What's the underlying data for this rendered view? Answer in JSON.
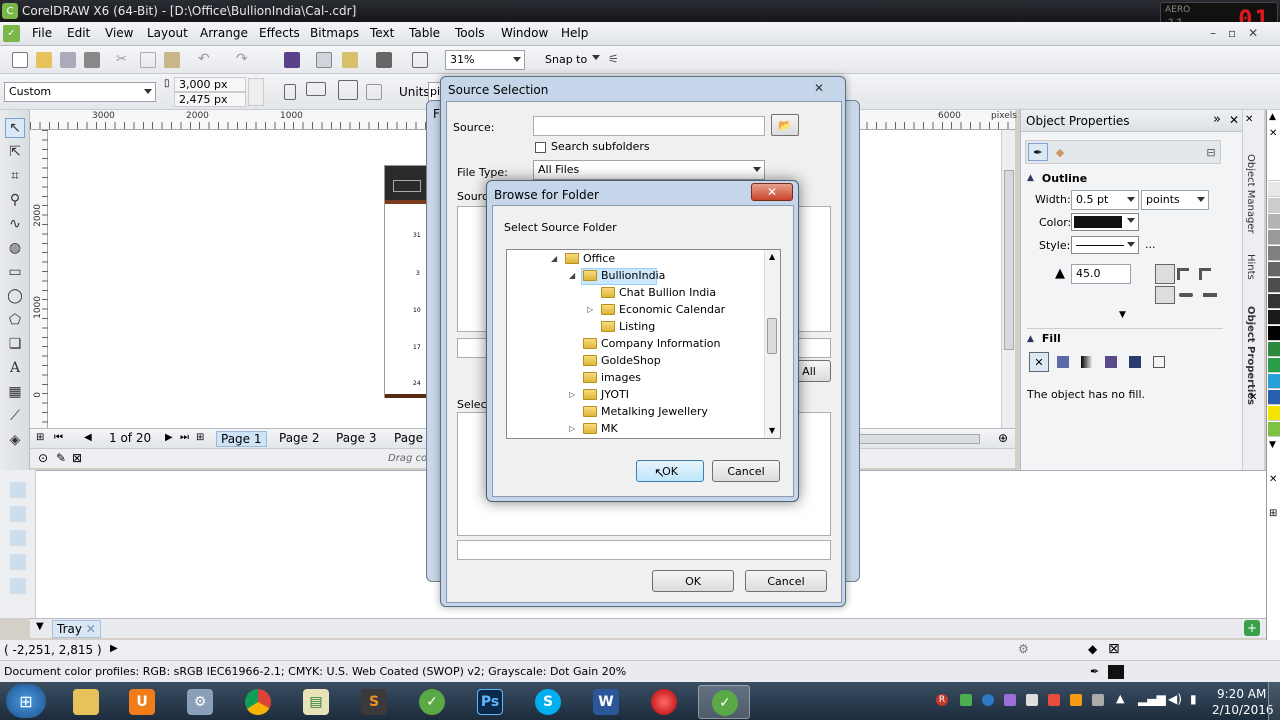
{
  "titlebar": {
    "title": "CorelDRAW X6 (64-Bit) - [D:\\Office\\BullionIndia\\Cal-.cdr]",
    "logo": "C",
    "gadget_label": "AERO",
    "clock_digits": "01",
    "clock_small": "11"
  },
  "menubar": {
    "items": [
      "File",
      "Edit",
      "View",
      "Layout",
      "Arrange",
      "Effects",
      "Bitmaps",
      "Text",
      "Table",
      "Tools",
      "Window",
      "Help"
    ]
  },
  "toolbar1": {
    "zoom": "31%",
    "snap_to": "Snap to"
  },
  "toolbar2": {
    "page_preset": "Custom",
    "width": "3,000 px",
    "height": "2,475 px",
    "units_label": "Units:",
    "units_value": "pi"
  },
  "ruler": {
    "h_labels": [
      "3000",
      "2000",
      "1000",
      "6000",
      "pixels"
    ],
    "v_labels": [
      "2000",
      "1000",
      "0"
    ],
    "corner": "pixels"
  },
  "page_thumb": {
    "numbers": [
      "31",
      "3",
      "10",
      "17",
      "24"
    ]
  },
  "pagebar": {
    "page_of": "1 of 20",
    "tabs": [
      "Page 1",
      "Page 2",
      "Page 3",
      "Page"
    ]
  },
  "canvas_status": {
    "hint": "Drag co"
  },
  "tray": {
    "label": "Tray"
  },
  "coords": {
    "value": "( -2,251, 2,815 )"
  },
  "profile": {
    "text": "Document color profiles: RGB: sRGB IEC61966-2.1; CMYK: U.S. Web Coated (SWOP) v2; Grayscale: Dot Gain 20%"
  },
  "docker": {
    "title": "Object Properties",
    "outline": {
      "heading": "Outline",
      "width_label": "Width:",
      "width_value": "0.5 pt",
      "units": "points",
      "color_label": "Color:",
      "style_label": "Style:",
      "style_more": "...",
      "angle": "45.0"
    },
    "fill": {
      "heading": "Fill",
      "message": "The object has no fill."
    },
    "side_tabs": [
      "Object Manager",
      "Hints",
      "Object Properties"
    ]
  },
  "source_dialog": {
    "title": "Source Selection",
    "source_label": "Source:",
    "search_subfolders": "Search subfolders",
    "file_type_label": "File Type:",
    "file_type_value": "All Files",
    "source_files_label": "Source",
    "selected_label": "Selecte",
    "add_all": "All",
    "ok": "OK",
    "cancel": "Cancel"
  },
  "browse_dialog": {
    "title": "Browse for Folder",
    "prompt": "Select Source Folder",
    "tree": [
      {
        "name": "Office",
        "expanded": true
      },
      {
        "name": "BullionIndia",
        "expanded": true,
        "selected": true
      },
      {
        "name": "Chat Bullion India"
      },
      {
        "name": "Economic Calendar",
        "has_children": true
      },
      {
        "name": "Listing"
      },
      {
        "name": "Company Information"
      },
      {
        "name": "GoldeShop"
      },
      {
        "name": "images"
      },
      {
        "name": "JYOTI",
        "has_children": true
      },
      {
        "name": "Metalking Jewellery"
      },
      {
        "name": "MK",
        "has_children": true
      }
    ],
    "ok": "OK",
    "cancel": "Cancel"
  },
  "taskbar": {
    "apps": [
      "Windows Explorer",
      "UC Browser",
      "Control Panel",
      "Google Chrome",
      "Excel",
      "Sublime",
      "CorelDRAW",
      "Photoshop",
      "Skype",
      "Word",
      "Media",
      "CorelDRAW X6"
    ],
    "time": "9:20 AM",
    "date": "2/10/2016"
  },
  "colors": {
    "selection": "#cce8ff",
    "title_bar": "#1d2026",
    "taskbar": "#2a3b4e"
  }
}
